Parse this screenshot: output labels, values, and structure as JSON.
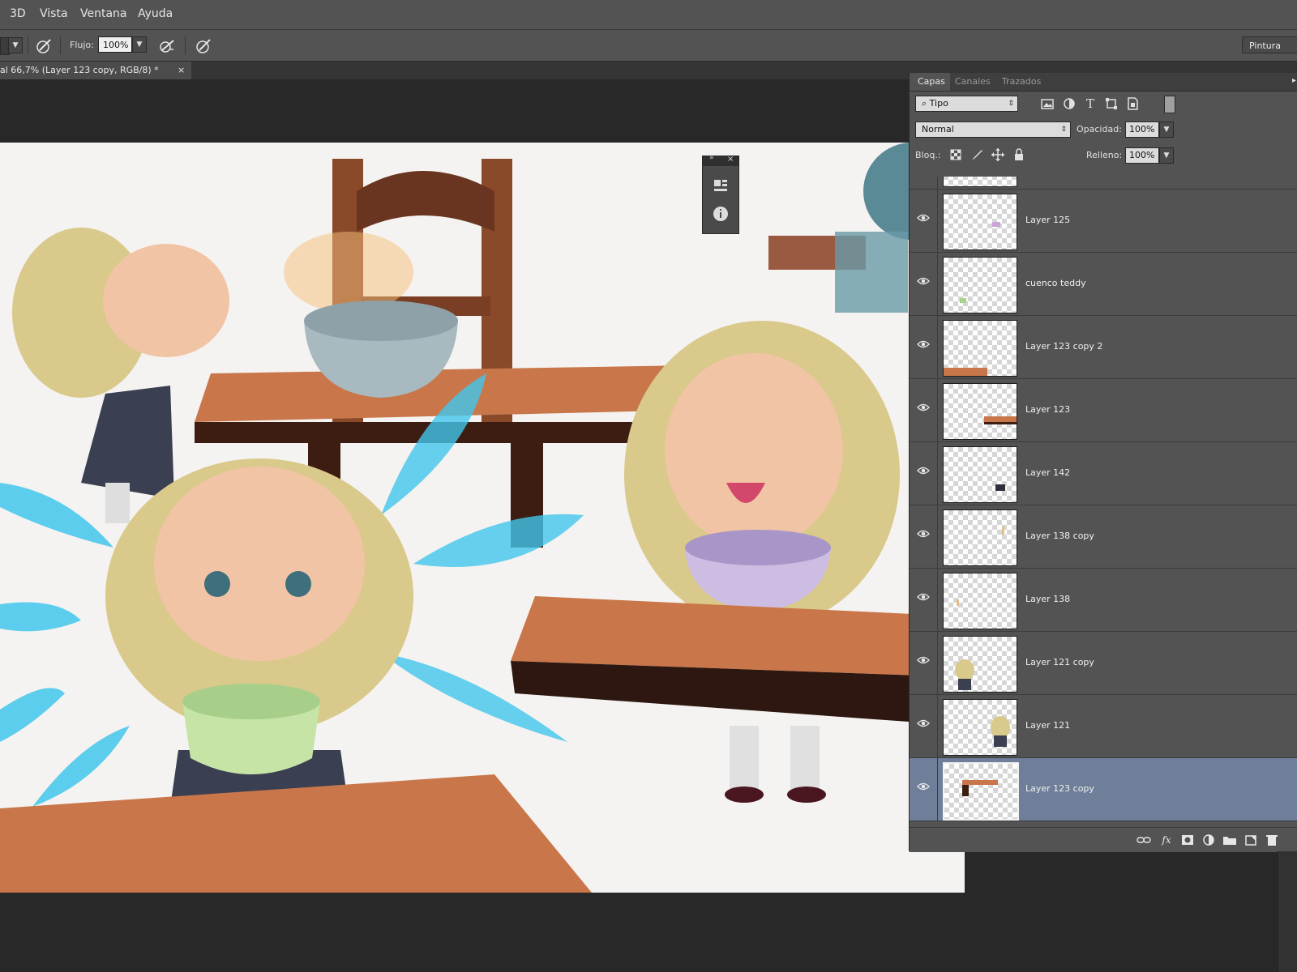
{
  "menubar": {
    "items": [
      "3D",
      "Vista",
      "Ventana",
      "Ayuda"
    ]
  },
  "options_bar": {
    "flow_label": "Flujo:",
    "flow_value": "100%",
    "workspace": "Pintura",
    "icons": [
      "airbrush-icon",
      "smoothing-icon",
      "pressure-icon"
    ]
  },
  "document_tab": {
    "title": "al 66,7% (Layer 123 copy, RGB/8) *",
    "close": "×"
  },
  "layers_panel": {
    "tabs": [
      "Capas",
      "Canales",
      "Trazados"
    ],
    "active_tab": "Capas",
    "filter": {
      "kind": "Tipo"
    },
    "blend_mode": "Normal",
    "opacity_label": "Opacidad:",
    "opacity_value": "100%",
    "lock_label": "Bloq.:",
    "fill_label": "Relleno:",
    "fill_value": "100%",
    "layers": [
      {
        "name": "Layer 125",
        "visible": true,
        "selected": false
      },
      {
        "name": "cuenco teddy",
        "visible": true,
        "selected": false
      },
      {
        "name": "Layer 123 copy 2",
        "visible": true,
        "selected": false
      },
      {
        "name": "Layer 123",
        "visible": true,
        "selected": false
      },
      {
        "name": "Layer 142",
        "visible": true,
        "selected": false
      },
      {
        "name": "Layer 138 copy",
        "visible": true,
        "selected": false
      },
      {
        "name": "Layer 138",
        "visible": true,
        "selected": false
      },
      {
        "name": "Layer 121 copy",
        "visible": true,
        "selected": false
      },
      {
        "name": "Layer 121",
        "visible": true,
        "selected": false
      },
      {
        "name": "Layer 123 copy",
        "visible": true,
        "selected": true
      }
    ],
    "footer_icons": [
      "link-icon",
      "fx-icon",
      "mask-icon",
      "adjustment-icon",
      "folder-icon",
      "new-layer-icon",
      "trash-icon"
    ]
  },
  "colors": {
    "selected_row": "#6f7f99",
    "panel_bg": "#535353",
    "canvas_bg": "#f4f3f1"
  }
}
